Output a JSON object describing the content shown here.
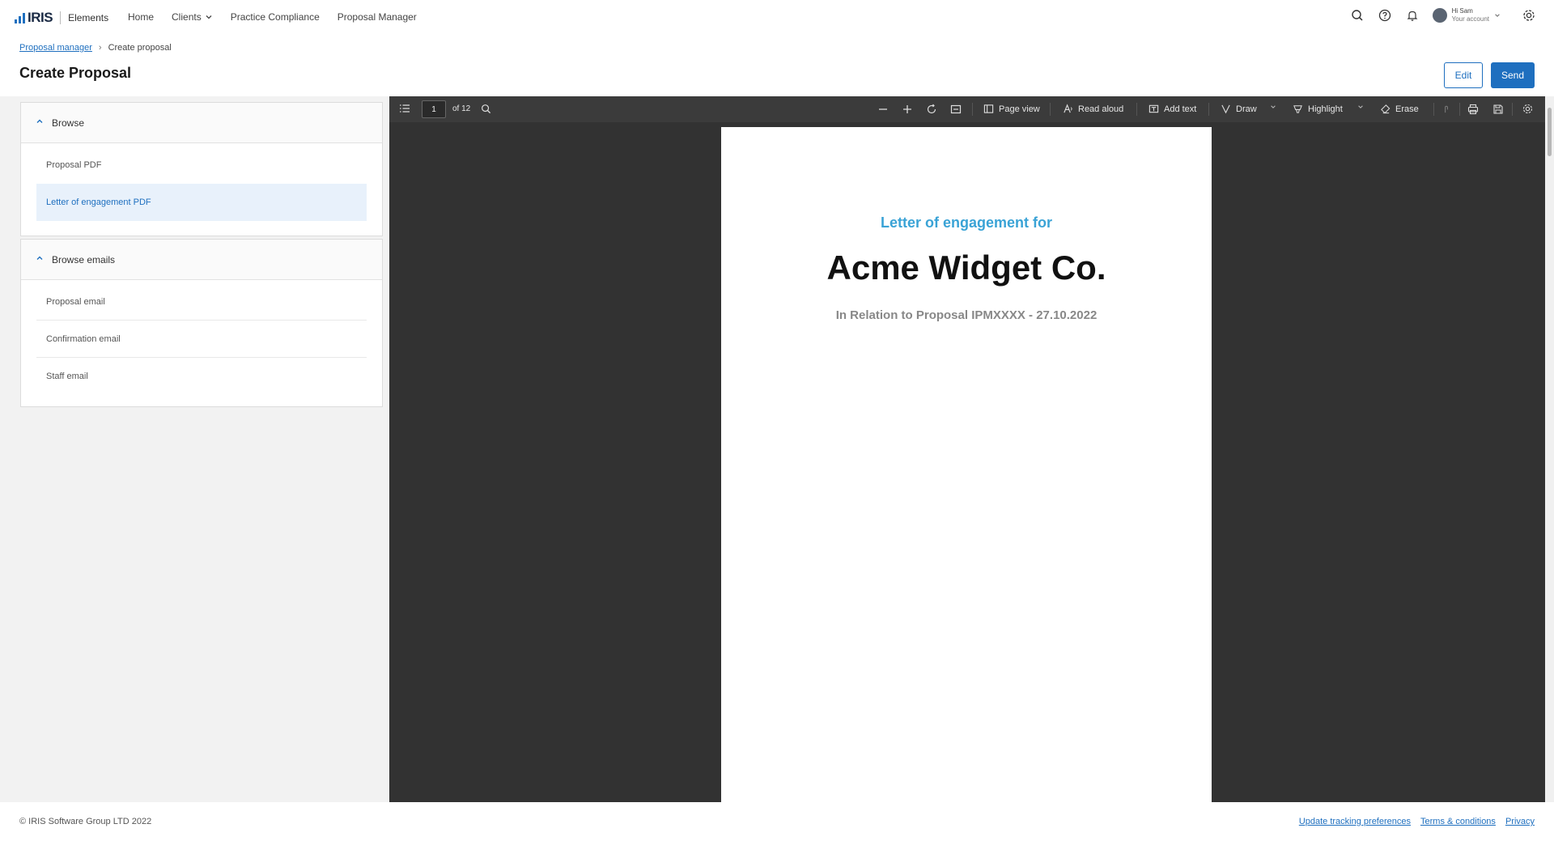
{
  "app": {
    "brand": "IRIS",
    "product": "Elements"
  },
  "nav": {
    "items": [
      {
        "label": "Home"
      },
      {
        "label": "Clients"
      },
      {
        "label": "Practice Compliance"
      },
      {
        "label": "Proposal Manager"
      }
    ],
    "account": {
      "greeting": "Hi Sam",
      "sub": "Your account"
    }
  },
  "breadcrumb": {
    "parent": "Proposal manager",
    "current": "Create proposal"
  },
  "page": {
    "title": "Create Proposal",
    "edit_label": "Edit",
    "send_label": "Send"
  },
  "browse": {
    "heading": "Browse",
    "items": [
      {
        "label": "Proposal PDF"
      },
      {
        "label": "Letter of engagement PDF",
        "active": true
      }
    ]
  },
  "browse_emails": {
    "heading": "Browse emails",
    "items": [
      {
        "label": "Proposal email"
      },
      {
        "label": "Confirmation email"
      },
      {
        "label": "Staff email"
      }
    ]
  },
  "viewer": {
    "page_number": "1",
    "page_total": "of 12",
    "tools": {
      "page_view": "Page view",
      "read_aloud": "Read aloud",
      "add_text": "Add text",
      "draw": "Draw",
      "highlight": "Highlight",
      "erase": "Erase"
    }
  },
  "document": {
    "subtitle": "Letter of engagement for",
    "client": "Acme Widget Co.",
    "relation": "In Relation to Proposal IPMXXXX - 27.10.2022"
  },
  "footer": {
    "copyright": "© IRIS Software Group LTD 2022",
    "links": [
      {
        "label": "Update tracking preferences"
      },
      {
        "label": "Terms & conditions"
      },
      {
        "label": "Privacy"
      }
    ]
  },
  "colors": {
    "accent": "#1e6fbf",
    "doc_subtitle": "#3aa3d6",
    "viewer_bg": "#323232"
  }
}
